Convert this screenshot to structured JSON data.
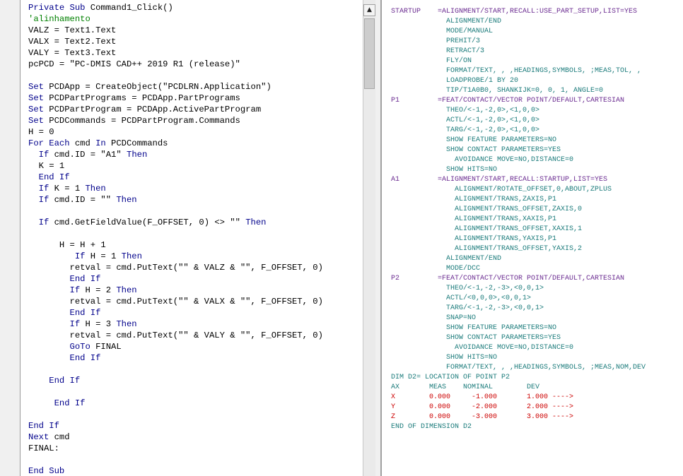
{
  "vb_editor": {
    "lines": [
      "Private Sub Command1_Click()",
      "'alinhamento",
      "VALZ = Text1.Text",
      "VALX = Text2.Text",
      "VALY = Text3.Text",
      "pcPCD = \"PC-DMIS CAD++ 2019 R1 (release)\"",
      "",
      "Set PCDApp = CreateObject(\"PCDLRN.Application\")",
      "Set PCDPartPrograms = PCDApp.PartPrograms",
      "Set PCDPartProgram = PCDApp.ActivePartProgram",
      "Set PCDCommands = PCDPartProgram.Commands",
      "H = 0",
      "For Each cmd In PCDCommands",
      "  If cmd.ID = \"A1\" Then",
      "  K = 1",
      "  End If",
      "  If K = 1 Then",
      "  If cmd.ID = \"\" Then",
      "",
      "  If cmd.GetFieldValue(F_OFFSET, 0) <> \"\" Then",
      "",
      "      H = H + 1",
      "         If H = 1 Then",
      "        retval = cmd.PutText(\"\" & VALZ & \"\", F_OFFSET, 0)",
      "        End If",
      "        If H = 2 Then",
      "        retval = cmd.PutText(\"\" & VALX & \"\", F_OFFSET, 0)",
      "        End If",
      "        If H = 3 Then",
      "        retval = cmd.PutText(\"\" & VALY & \"\", F_OFFSET, 0)",
      "        GoTo FINAL",
      "        End If",
      "",
      "    End If",
      "",
      "     End If",
      "",
      "End If",
      "Next cmd",
      "FINAL:",
      "",
      "End Sub"
    ]
  },
  "scrollbar": {
    "up_arrow": "▲"
  },
  "pcdmis": {
    "lines": [
      "STARTUP    =ALIGNMENT/START,RECALL:USE_PART_SETUP,LIST=YES",
      "             ALIGNMENT/END",
      "             MODE/MANUAL",
      "             PREHIT/3",
      "             RETRACT/3",
      "             FLY/ON",
      "             FORMAT/TEXT, , ,HEADINGS,SYMBOLS, ;MEAS,TOL, ,",
      "             LOADPROBE/1 BY 20",
      "             TIP/T1A0B0, SHANKIJK=0, 0, 1, ANGLE=0",
      "P1         =FEAT/CONTACT/VECTOR POINT/DEFAULT,CARTESIAN",
      "             THEO/<-1,-2,0>,<1,0,0>",
      "             ACTL/<-1,-2,0>,<1,0,0>",
      "             TARG/<-1,-2,0>,<1,0,0>",
      "             SHOW FEATURE PARAMETERS=NO",
      "             SHOW CONTACT PARAMETERS=YES",
      "               AVOIDANCE MOVE=NO,DISTANCE=0",
      "             SHOW HITS=NO",
      "A1         =ALIGNMENT/START,RECALL:STARTUP,LIST=YES",
      "               ALIGNMENT/ROTATE_OFFSET,0,ABOUT,ZPLUS",
      "               ALIGNMENT/TRANS,ZAXIS,P1",
      "               ALIGNMENT/TRANS_OFFSET,ZAXIS,0",
      "               ALIGNMENT/TRANS,XAXIS,P1",
      "               ALIGNMENT/TRANS_OFFSET,XAXIS,1",
      "               ALIGNMENT/TRANS,YAXIS,P1",
      "               ALIGNMENT/TRANS_OFFSET,YAXIS,2",
      "             ALIGNMENT/END",
      "             MODE/DCC",
      "P2         =FEAT/CONTACT/VECTOR POINT/DEFAULT,CARTESIAN",
      "             THEO/<-1,-2,-3>,<0,0,1>",
      "             ACTL/<0,0,0>,<0,0,1>",
      "             TARG/<-1,-2,-3>,<0,0,1>",
      "             SNAP=NO",
      "             SHOW FEATURE PARAMETERS=NO",
      "             SHOW CONTACT PARAMETERS=YES",
      "               AVOIDANCE MOVE=NO,DISTANCE=0",
      "             SHOW HITS=NO",
      "             FORMAT/TEXT, , ,HEADINGS,SYMBOLS, ;MEAS,NOM,DEV",
      "DIM D2= LOCATION OF POINT P2",
      "AX       MEAS    NOMINAL        DEV",
      "X        0.000     -1.000       1.000 ---->",
      "Y        0.000     -2.000       2.000 ---->",
      "Z        0.000     -3.000       3.000 ---->",
      "END OF DIMENSION D2"
    ]
  }
}
